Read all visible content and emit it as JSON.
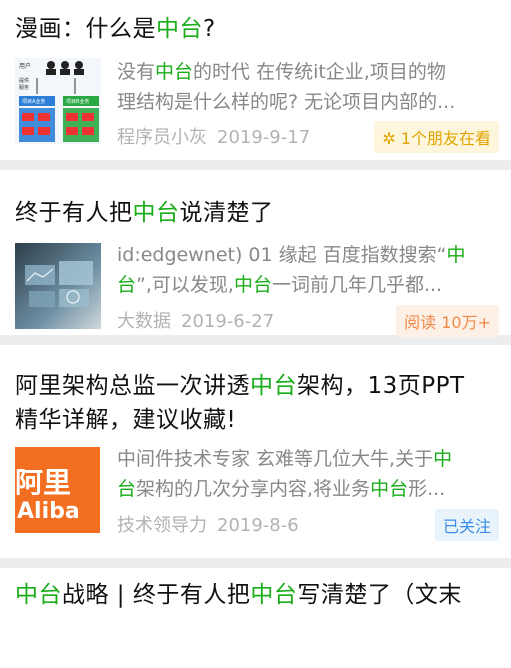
{
  "articles": [
    {
      "title": [
        {
          "t": "漫画：什么是"
        },
        {
          "t": "中台",
          "hl": true
        },
        {
          "t": "?"
        }
      ],
      "snippet_line1": [
        {
          "t": "没有"
        },
        {
          "t": "中台",
          "hl": true
        },
        {
          "t": "的时代 在传统it企业,项目的物"
        }
      ],
      "snippet_line2": [
        {
          "t": "理结构是什么样的呢? 无论项目内部的..."
        }
      ],
      "source": "程序员小灰",
      "date": "2019-9-17",
      "badge": "1个朋友在看",
      "badge_icon": "friends-reading-icon",
      "thumb_labels": {
        "user": "用户",
        "a": "项目A业务",
        "b": "项目B业务"
      }
    },
    {
      "title": [
        {
          "t": "终于有人把"
        },
        {
          "t": "中台",
          "hl": true
        },
        {
          "t": "说清楚了"
        }
      ],
      "snippet_line1": [
        {
          "t": "id:edgewnet) 01 缘起 百度指数搜索“"
        },
        {
          "t": "中",
          "hl": true
        }
      ],
      "snippet_line2": [
        {
          "t": "台",
          "hl": true
        },
        {
          "t": "”,可以发现,"
        },
        {
          "t": "中台",
          "hl": true
        },
        {
          "t": "一词前几年几乎都..."
        }
      ],
      "source": "大数据",
      "date": "2019-6-27",
      "badge": "阅读 10万+"
    },
    {
      "title_line1": [
        {
          "t": "阿里架构总监一次讲透"
        },
        {
          "t": "中台",
          "hl": true
        },
        {
          "t": "架构，13页PPT"
        }
      ],
      "title_line2": [
        {
          "t": "精华详解，建议收藏!"
        }
      ],
      "snippet_line1": [
        {
          "t": "中间件技术专家 玄难等几位大牛,关于"
        },
        {
          "t": "中",
          "hl": true
        }
      ],
      "snippet_line2": [
        {
          "t": "台",
          "hl": true
        },
        {
          "t": "架构的几次分享内容,将业务"
        },
        {
          "t": "中台",
          "hl": true
        },
        {
          "t": "形..."
        }
      ],
      "source": "技术领导力",
      "date": "2019-8-6",
      "badge": "已关注",
      "thumb_text": "阿里",
      "thumb_text2": "Aliba"
    },
    {
      "title_line1": [
        {
          "t": "中台",
          "hl": true
        },
        {
          "t": "战略 | 终于有人把"
        },
        {
          "t": "中台",
          "hl": true
        },
        {
          "t": "写清楚了（文末"
        }
      ]
    }
  ],
  "colors": {
    "highlight": "#1aad19",
    "separator": "#ededed",
    "meta": "#b2b2b2"
  }
}
